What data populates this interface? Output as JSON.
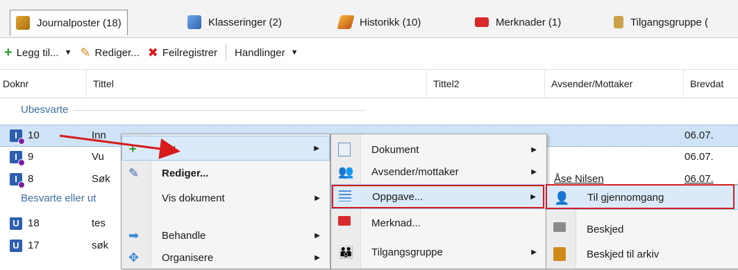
{
  "tabs": [
    {
      "label": "Journalposter (18)",
      "icon": "journal-icon"
    },
    {
      "label": "Klasseringer (2)",
      "icon": "folder-icon"
    },
    {
      "label": "Historikk (10)",
      "icon": "history-icon"
    },
    {
      "label": "Merknader (1)",
      "icon": "comment-icon"
    },
    {
      "label": "Tilgangsgruppe (",
      "icon": "lock-icon"
    }
  ],
  "toolbar": {
    "add_label": "Legg til...",
    "edit_label": "Rediger...",
    "void_label": "Feilregistrer",
    "actions_label": "Handlinger"
  },
  "columns": [
    "Doknr",
    "Tittel",
    "Tittel2",
    "Avsender/Mottaker",
    "Brevdat"
  ],
  "groups": {
    "unanswered": "Ubesvarte",
    "answered": "Besvarte eller ut"
  },
  "rows": [
    {
      "badge": "I",
      "doknr": "10",
      "tittel": "Inn",
      "date": "06.07.",
      "sender": ""
    },
    {
      "badge": "I",
      "doknr": "9",
      "tittel": "Vu",
      "date": "06.07.",
      "sender": ""
    },
    {
      "badge": "I",
      "doknr": "8",
      "tittel": "Søk",
      "date": "06.07.",
      "sender": "Åse Nilsen"
    },
    {
      "badge": "U",
      "doknr": "18",
      "tittel": "tes",
      "date": "",
      "sender": ""
    },
    {
      "badge": "U",
      "doknr": "17",
      "tittel": "søk",
      "date": "",
      "sender": ""
    }
  ],
  "menu1": [
    {
      "label": "Ny",
      "submenu": true,
      "highlight": true
    },
    {
      "label": "Rediger...",
      "bold": true
    },
    {
      "label": "Vis dokument",
      "submenu": true
    },
    {
      "label": "Behandle",
      "submenu": true
    },
    {
      "label": "Organisere",
      "submenu": true
    }
  ],
  "menu2": [
    {
      "label": "Dokument",
      "submenu": true
    },
    {
      "label": "Avsender/mottaker",
      "submenu": true
    },
    {
      "label": "Oppgave...",
      "submenu": true,
      "highlight": true
    },
    {
      "label": "Merknad..."
    },
    {
      "label": "Tilgangsgruppe",
      "submenu": true
    }
  ],
  "menu3": [
    {
      "label": "Til gjennomgang",
      "highlight": true
    },
    {
      "label": "Beskjed"
    },
    {
      "label": "Beskjed til arkiv"
    }
  ],
  "colors": {
    "annotation_red": "#d71a1a",
    "selection": "#cfe3f7",
    "badge_blue": "#2d5fb0"
  }
}
